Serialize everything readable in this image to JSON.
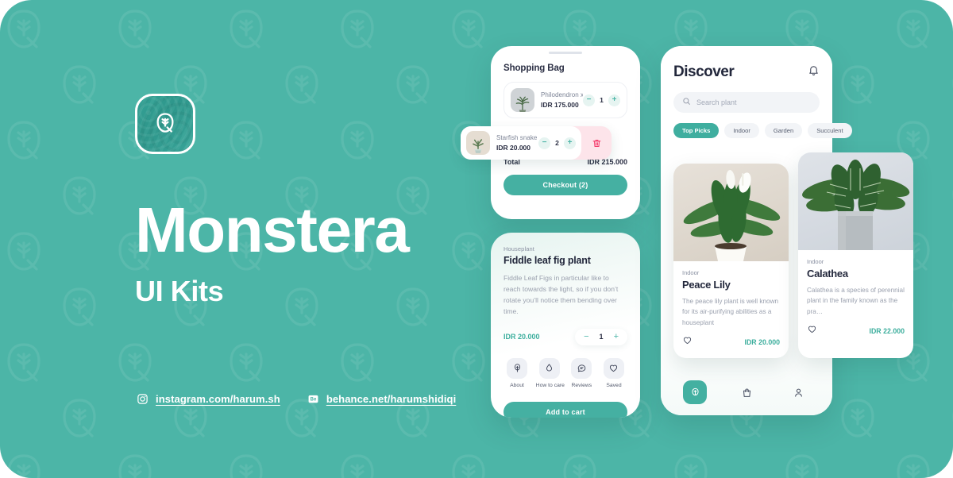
{
  "brand": {
    "title": "Monstera",
    "subtitle": "UI Kits",
    "logo_icon": "leaf-icon",
    "background_color": "#4cb5a7",
    "accent_color": "#45b0a2",
    "price_color": "#3cae9d",
    "danger_color": "#fde4ea"
  },
  "footer": {
    "links": [
      {
        "icon": "instagram-icon",
        "label": "instagram.com/harum.sh"
      },
      {
        "icon": "behance-icon",
        "label": "behance.net/harumshidiqi"
      }
    ]
  },
  "shopping_bag": {
    "title": "Shopping Bag",
    "items": [
      {
        "name": "Philodendron xanadu",
        "price": "IDR 175.000",
        "qty": "1",
        "minus": "−",
        "plus": "+"
      },
      {
        "name": "Starfish snake",
        "price": "IDR 20.000",
        "qty": "2",
        "minus": "−",
        "plus": "+",
        "delete_icon": "trash-icon"
      }
    ],
    "total_label": "Total",
    "total_value": "IDR 215.000",
    "checkout_label": "Checkout (2)"
  },
  "detail": {
    "eyebrow": "Houseplant",
    "title": "Fiddle leaf fig plant",
    "description": "Fiddle Leaf Figs in particular like to reach towards the light, so if you don’t rotate you’ll notice them bending over time.",
    "price": "IDR 20.000",
    "qty": "1",
    "minus": "−",
    "plus": "+",
    "actions": [
      {
        "icon": "tree-icon",
        "label": "About"
      },
      {
        "icon": "water-drop-icon",
        "label": "How to care"
      },
      {
        "icon": "chat-bubble-icon",
        "label": "Reviews"
      },
      {
        "icon": "heart-icon",
        "label": "Saved"
      }
    ],
    "cta_label": "Add to cart"
  },
  "discover": {
    "title": "Discover",
    "bell_icon": "bell-icon",
    "search": {
      "icon": "search-icon",
      "placeholder": "Search plant"
    },
    "chips": [
      {
        "label": "Top Picks",
        "active": true
      },
      {
        "label": "Indoor",
        "active": false
      },
      {
        "label": "Garden",
        "active": false
      },
      {
        "label": "Succulent",
        "active": false
      }
    ],
    "products": [
      {
        "category": "Indoor",
        "name": "Peace Lily",
        "description": "The peace lily plant is well known for its air-purifying abilities as a houseplant",
        "price": "IDR 20.000",
        "favorite_icon": "heart-icon"
      },
      {
        "category": "Indoor",
        "name": "Calathea",
        "description": "Calathea is a species of perennial plant in the family known as the pra…",
        "price": "IDR 22.000",
        "favorite_icon": "heart-icon"
      }
    ],
    "nav": [
      {
        "icon": "leaf-icon",
        "active": true
      },
      {
        "icon": "bag-icon",
        "active": false
      },
      {
        "icon": "person-icon",
        "active": false
      }
    ]
  }
}
